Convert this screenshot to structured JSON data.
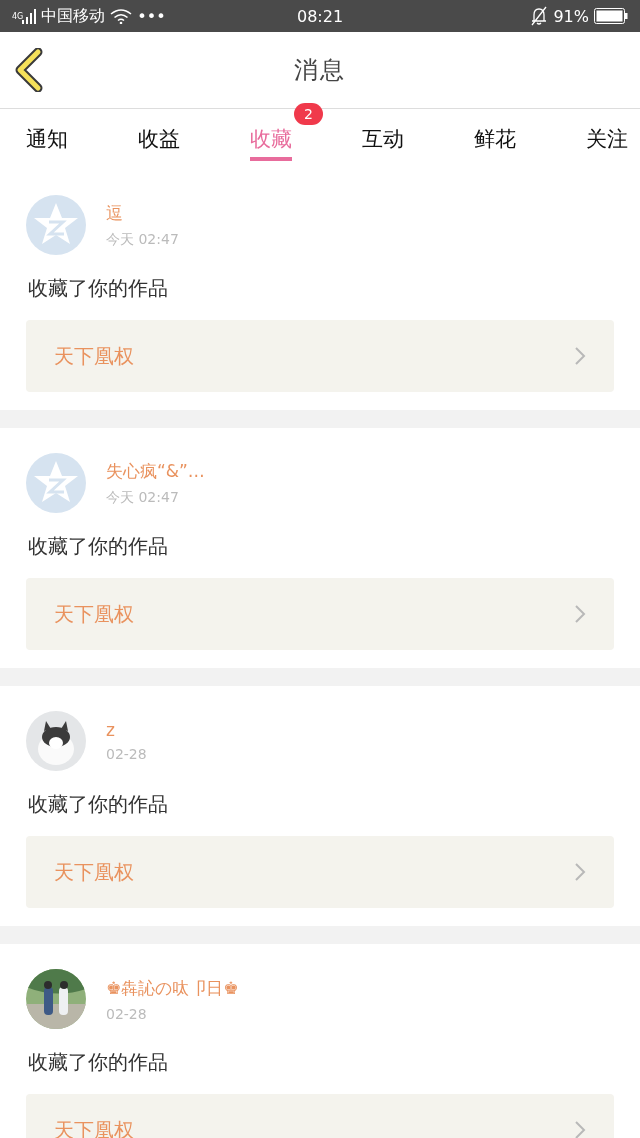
{
  "status_bar": {
    "network": "4G",
    "carrier": "中国移动",
    "more": "•••",
    "time": "08:21",
    "battery": "91%"
  },
  "header": {
    "title": "消息"
  },
  "tabs": [
    {
      "label": "通知",
      "selected": false
    },
    {
      "label": "收益",
      "selected": false
    },
    {
      "label": "收藏",
      "selected": true,
      "badge": "2"
    },
    {
      "label": "互动",
      "selected": false
    },
    {
      "label": "鲜花",
      "selected": false
    },
    {
      "label": "关注",
      "selected": false
    }
  ],
  "messages": [
    {
      "avatar": {
        "kind": "default"
      },
      "name": "逗",
      "time": "今天 02:47",
      "text": "收藏了你的作品",
      "work": "天下凰权"
    },
    {
      "avatar": {
        "kind": "default"
      },
      "name": "失心疯“&”…",
      "time": "今天 02:47",
      "text": "收藏了你的作品",
      "work": "天下凰权"
    },
    {
      "name": "z",
      "time": "02-28",
      "text": "收藏了你的作品",
      "work": "天下凰权"
    },
    {
      "name": "♚犇訫の呔卩日♚",
      "time": "02-28",
      "text": "收藏了你的作品",
      "work": "天下凰权"
    }
  ]
}
